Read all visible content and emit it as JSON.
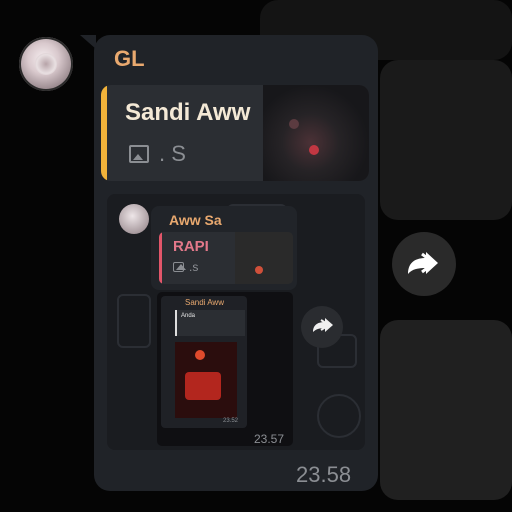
{
  "message": {
    "sender": "GL",
    "time": "23.58",
    "reply": {
      "name": "Sandi Aww",
      "media_label": ". S",
      "media_icon": "image-icon"
    }
  },
  "forwarded_message": {
    "sender": "Aww Sa",
    "reply": {
      "name": "RAPI",
      "media_label": ".s",
      "media_icon": "image-icon"
    },
    "time": "23.57",
    "nested_screenshot": {
      "sender": "Sandi Aww",
      "reply_name": "Anda",
      "time": "23.52"
    }
  },
  "actions": {
    "forward_icon": "forward-icon",
    "inner_forward_icon": "forward-icon"
  },
  "colors": {
    "bubble": "#202328",
    "sender_name": "#e9a96f",
    "reply_bar": "#f2b33a",
    "inner_reply_bar": "#e2566a",
    "background": "#050505"
  }
}
